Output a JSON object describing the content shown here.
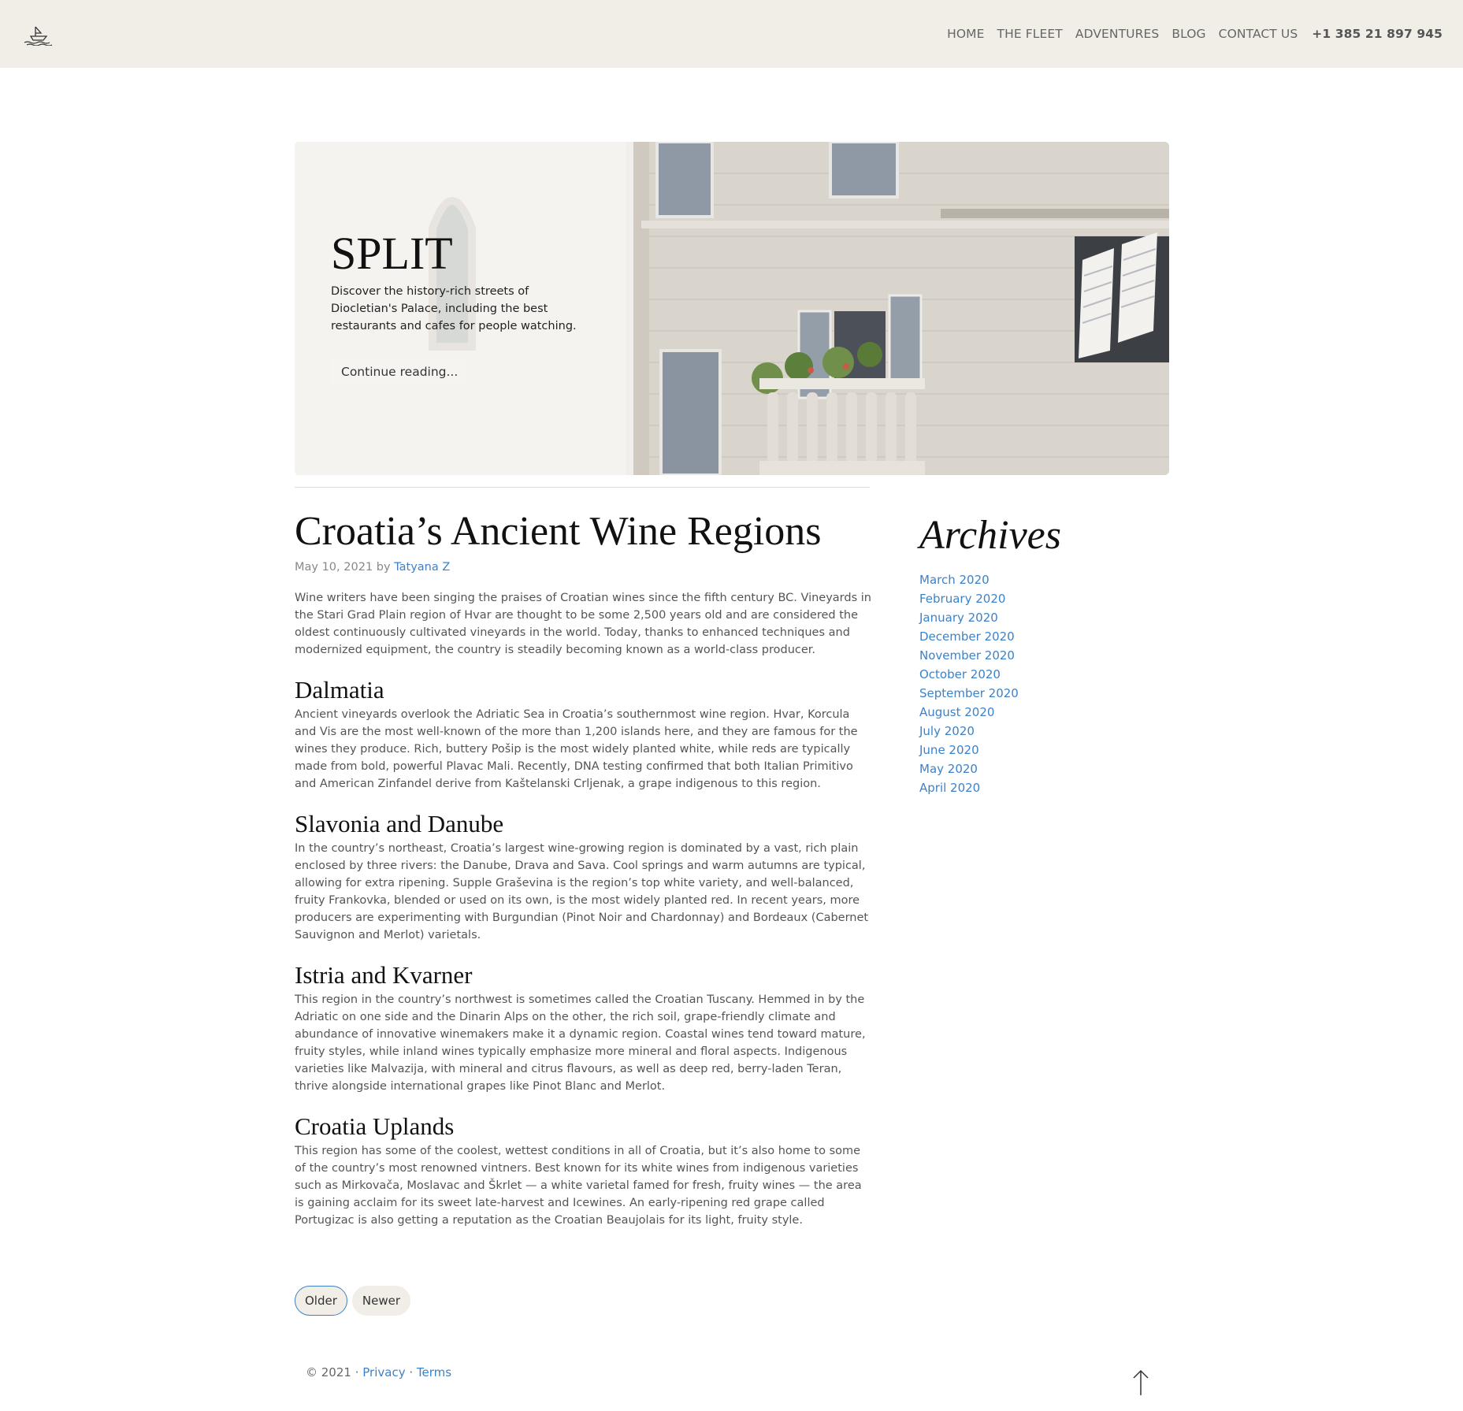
{
  "header": {
    "logo_icon": "ship-icon",
    "nav": [
      "HOME",
      "THE FLEET",
      "ADVENTURES",
      "BLOG",
      "CONTACT US"
    ],
    "phone": "+1 385 21 897 945"
  },
  "hero": {
    "title": "SPLIT",
    "description": "Discover the history-rich streets of Diocletian's Palace, including the best restaurants and cafes for people watching.",
    "button": "Continue reading..."
  },
  "article": {
    "title": "Croatia’s Ancient Wine Regions",
    "date": "May 10, 2021",
    "by": "by",
    "author": "Tatyana Z",
    "intro": "Wine writers have been singing the praises of Croatian wines since the fifth century BC. Vineyards in the Stari Grad Plain region of Hvar are thought to be some 2,500 years old and are considered the oldest continuously cultivated vineyards in the world. Today, thanks to enhanced techniques and modernized equipment, the country is steadily becoming known as a world-class producer.",
    "sections": [
      {
        "heading": "Dalmatia",
        "text": "Ancient vineyards overlook the Adriatic Sea in Croatia’s southernmost wine region. Hvar, Korcula and Vis are the most well-known of the more than 1,200 islands here, and they are famous for the wines they produce. Rich, buttery Pošip is the most widely planted white, while reds are typically made from bold, powerful Plavac Mali. Recently, DNA testing confirmed that both Italian Primitivo and American Zinfandel derive from Kaštelanski Crljenak, a grape indigenous to this region."
      },
      {
        "heading": "Slavonia and Danube",
        "text": "In the country’s northeast, Croatia’s largest wine-growing region is dominated by a vast, rich plain enclosed by three rivers: the Danube, Drava and Sava. Cool springs and warm autumns are typical, allowing for extra ripening. Supple Graševina is the region’s top white variety, and well-balanced, fruity Frankovka, blended or used on its own, is the most widely planted red. In recent years, more producers are experimenting with Burgundian (Pinot Noir and Chardonnay) and Bordeaux (Cabernet Sauvignon and Merlot) varietals."
      },
      {
        "heading": "Istria and Kvarner",
        "text": "This region in the country’s northwest is sometimes called the Croatian Tuscany. Hemmed in by the Adriatic on one side and the Dinarin Alps on the other, the rich soil, grape-friendly climate and abundance of innovative winemakers make it a dynamic region. Coastal wines tend toward mature, fruity styles, while inland wines typically emphasize more mineral and floral aspects. Indigenous varieties like Malvazija, with mineral and citrus flavours, as well as deep red, berry-laden Teran, thrive alongside international grapes like Pinot Blanc and Merlot."
      },
      {
        "heading": "Croatia Uplands",
        "text": "This region has some of the coolest, wettest conditions in all of Croatia, but it’s also home to some of the country’s most renowned vintners. Best known for its white wines from indigenous varieties such as Mirkovača, Moslavac and Škrlet — a white varietal famed for fresh, fruity wines — the area is gaining acclaim for its sweet late-harvest and Icewines. An early-ripening red grape called Portugizac is also getting a reputation as the Croatian Beaujolais for its light, fruity style."
      }
    ]
  },
  "archives": {
    "title": "Archives",
    "items": [
      "March 2020",
      "February 2020",
      "January 2020",
      "December 2020",
      "November 2020",
      "October 2020",
      "September 2020",
      "August 2020",
      "July 2020",
      "June 2020",
      "May 2020",
      "April 2020"
    ]
  },
  "pager": {
    "older": "Older",
    "newer": "Newer"
  },
  "footer": {
    "copyright": "© 2021 ·",
    "privacy": "Privacy",
    "sep": "·",
    "terms": "Terms",
    "top_icon": "arrow-up-icon"
  },
  "colors": {
    "header_bg": "#f1eee8",
    "link": "#3b82c9"
  }
}
